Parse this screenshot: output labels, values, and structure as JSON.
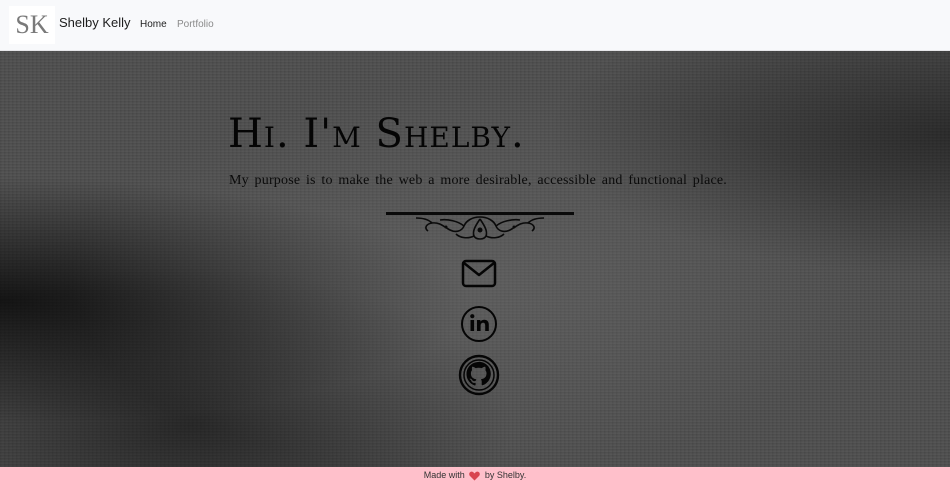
{
  "nav": {
    "logo": "SK",
    "brand": "Shelby Kelly",
    "links": [
      {
        "label": "Home"
      },
      {
        "label": "Portfolio"
      }
    ]
  },
  "hero": {
    "title": "Hi. I'm Shelby.",
    "subtitle": "My purpose is to make the web a more desirable, accessible and functional place.",
    "social_icons": [
      "email-icon",
      "linkedin-icon",
      "github-icon"
    ]
  },
  "footer": {
    "prefix": "Made with",
    "suffix": "by Shelby.",
    "icon": "heart-icon"
  },
  "colors": {
    "navbar_bg": "#f8f9fb",
    "hero_bg": "#4d4d4d",
    "footer_bg": "#ffc0cb",
    "heart": "#d9434f"
  }
}
